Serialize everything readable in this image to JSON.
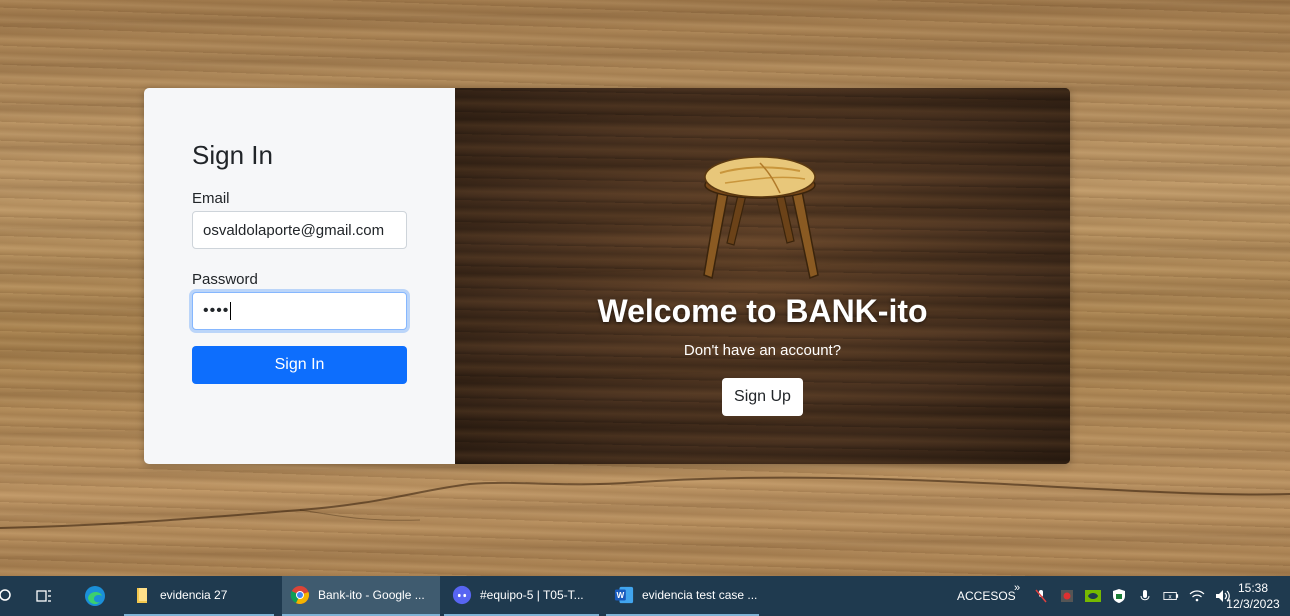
{
  "signin": {
    "title": "Sign In",
    "email_label": "Email",
    "email_value": "osvaldolaporte@gmail.com",
    "password_label": "Password",
    "password_value": "••••",
    "submit_label": "Sign In"
  },
  "welcome": {
    "heading": "Welcome to BANK-ito",
    "prompt": "Don't have an account?",
    "signup_label": "Sign Up"
  },
  "taskbar": {
    "apps": [
      {
        "label": "evidencia 27",
        "icon": "folder-icon"
      },
      {
        "label": "Bank-ito - Google ...",
        "icon": "chrome-icon",
        "active": true
      },
      {
        "label": "#equipo-5 | T05-T...",
        "icon": "discord-icon"
      },
      {
        "label": "evidencia test case ...",
        "icon": "word-icon"
      }
    ],
    "tray_label": "ACCESOS",
    "time": "15:38",
    "date": "12/3/2023"
  },
  "colors": {
    "primary": "#0d6efd",
    "taskbar": "#1f3a4f",
    "card_left": "#f6f7f9"
  }
}
